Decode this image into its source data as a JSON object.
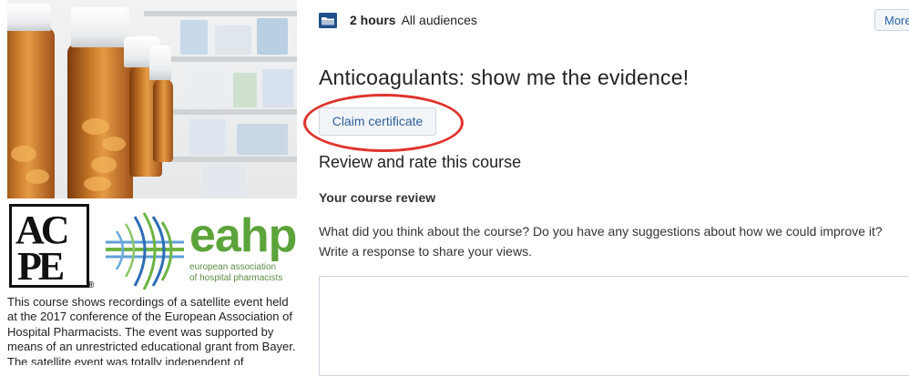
{
  "sidebar": {
    "hero_image": "pharmacy-pill-bottles-photo",
    "logos": {
      "acpe_line1": "AC",
      "acpe_line2": "PE",
      "acpe_mark": "®",
      "eahp_word": "eahp",
      "eahp_subtitle_1": "european association",
      "eahp_subtitle_2": "of hospital pharmacists"
    },
    "description": "This course shows recordings of a satellite event held at the 2017 conference of the European Association of Hospital Pharmacists. The event was supported by means of an unrestricted educational grant from Bayer. The satellite event was totally independent of"
  },
  "meta": {
    "icon": "folder-icon",
    "duration": "2 hours",
    "audience": "All audiences",
    "more_label": "More"
  },
  "course": {
    "title": "Anticoagulants: show me the evidence!",
    "claim_label": "Claim certificate"
  },
  "review": {
    "heading": "Review and rate this course",
    "label": "Your course review",
    "prompt_line1": "What did you think about the course? Do you have any suggestions about how we could improve it?",
    "prompt_line2": "Write a response to share your views.",
    "value": ""
  },
  "colors": {
    "link_blue": "#2e5f9a",
    "highlight_red": "#e0332c",
    "eahp_green": "#5ba33a",
    "folder_blue": "#1f4f8a"
  }
}
